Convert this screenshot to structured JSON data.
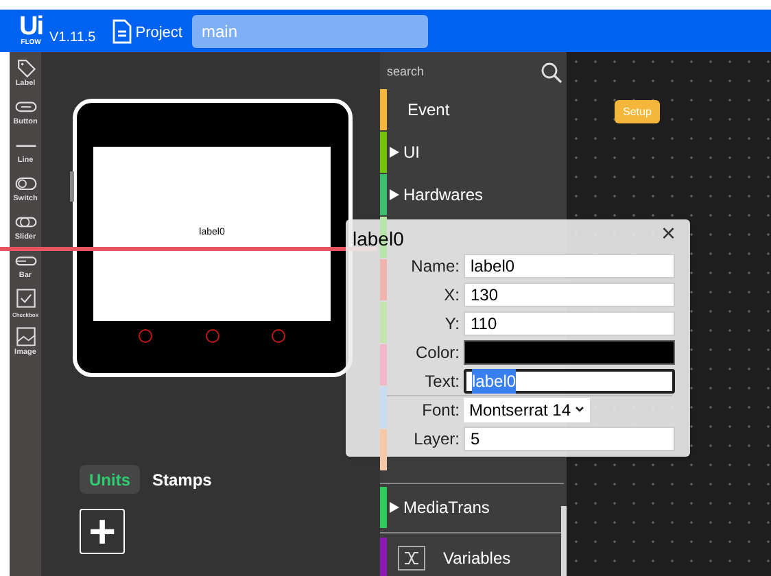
{
  "header": {
    "logo_top": "Ui",
    "logo_bottom": "FLOW",
    "version": "V1.11.5",
    "project_label": "Project",
    "file_name": "main"
  },
  "toolbox": [
    {
      "kind": "label",
      "label": "Label"
    },
    {
      "kind": "button",
      "label": "Button"
    },
    {
      "kind": "line",
      "label": "Line"
    },
    {
      "kind": "switch",
      "label": "Switch"
    },
    {
      "kind": "slider",
      "label": "Slider"
    },
    {
      "kind": "bar",
      "label": "Bar"
    },
    {
      "kind": "checkbox",
      "label": "Checkbox"
    },
    {
      "kind": "image",
      "label": "Image"
    }
  ],
  "device": {
    "screen_label": "label0"
  },
  "tabs": [
    {
      "label": "Units",
      "selected": true
    },
    {
      "label": "Stamps",
      "selected": false
    }
  ],
  "add_button": "+",
  "search": {
    "placeholder": "search"
  },
  "categories": [
    {
      "label": "Event",
      "color": "#f5b73b",
      "arrow": false
    },
    {
      "label": "UI",
      "color": "#74c40c",
      "arrow": true
    },
    {
      "label": "Hardwares",
      "color": "#3cbf6c",
      "arrow": true
    },
    {
      "color": "#b7e4a8"
    },
    {
      "color": "#f0b3ad"
    },
    {
      "color": "#c6e4b0"
    },
    {
      "color": "#f0b8c8"
    },
    {
      "color": "#c9dcf2"
    },
    {
      "color": "#f5c8a8"
    },
    {
      "label": "MediaTrans",
      "color": "#2ecc5a",
      "arrow": true
    },
    {
      "label": "Variables",
      "color": "#8a1ab0",
      "arrow": false
    }
  ],
  "workspace": {
    "block": "Setup"
  },
  "popup": {
    "title": "label0",
    "close": "×",
    "fields": [
      {
        "kind": "text",
        "label": "Name:",
        "value": "label0",
        "focused": false
      },
      {
        "kind": "text",
        "label": "X:",
        "value": "130",
        "focused": false
      },
      {
        "kind": "text",
        "label": "Y:",
        "value": "110",
        "focused": false
      },
      {
        "kind": "color",
        "label": "Color:",
        "color": "#000000"
      },
      {
        "kind": "text",
        "label": "Text:",
        "value": "label0",
        "focused": true
      },
      {
        "kind": "select",
        "label": "Font:",
        "value": "Montserrat 14"
      },
      {
        "kind": "text",
        "label": "Layer:",
        "value": "5",
        "focused": false
      }
    ]
  }
}
